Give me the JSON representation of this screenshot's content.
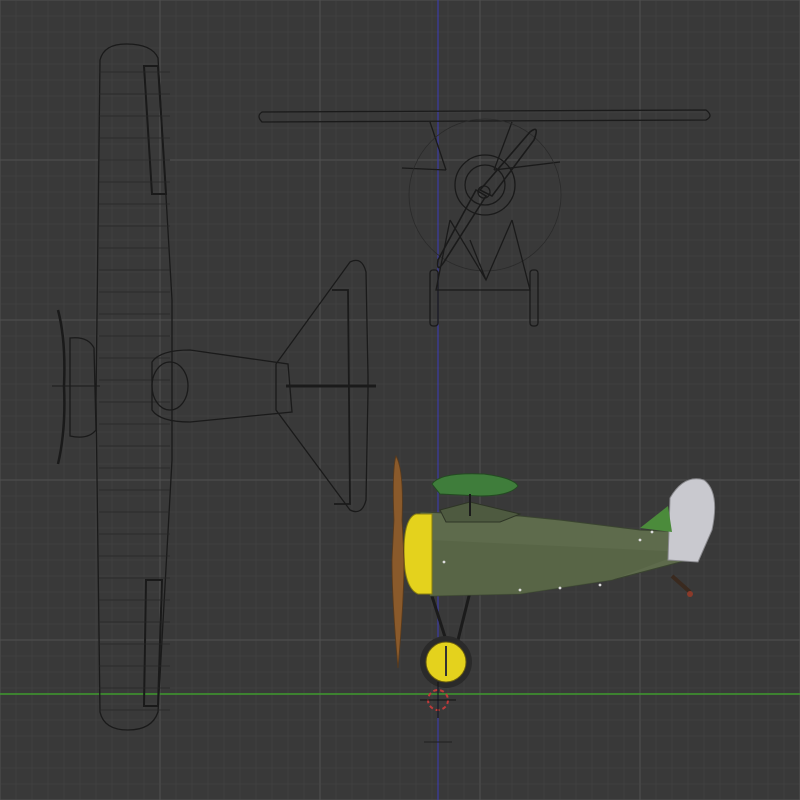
{
  "viewport": {
    "view": "front-orthographic",
    "grid": true,
    "colors": {
      "background": "#393939",
      "grid_minor": "#474747",
      "grid_major": "#515151",
      "axis_x": "#3f9a2e",
      "axis_z": "#3c3ca6",
      "blueprint_line": "#1a1a1a",
      "fuselage": "#5e6b4c",
      "cowling": "#e4d21d",
      "upper_wing": "#3f7d3b",
      "rudder": "#c9c9cf",
      "propeller": "#8a5a2b"
    }
  },
  "reference_images": [
    {
      "name": "top-view-blueprint"
    },
    {
      "name": "front-view-blueprint"
    }
  ],
  "model": {
    "name": "biplane-side-view"
  },
  "cursor": {
    "icon": "3d-cursor-icon"
  }
}
